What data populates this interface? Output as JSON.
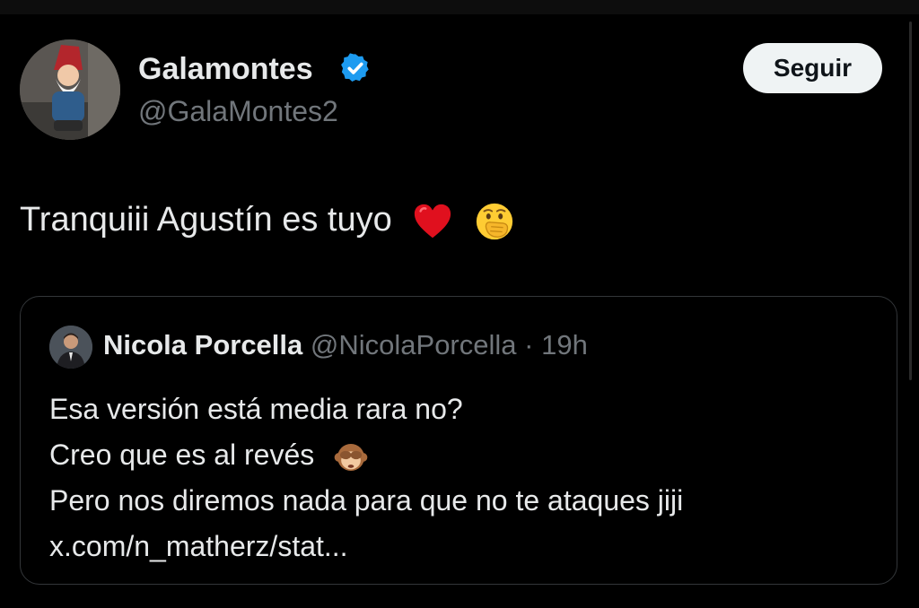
{
  "tweet": {
    "author_name": "Galamontes",
    "author_handle": "@GalaMontes2",
    "follow_label": "Seguir",
    "text": "Tranquiii Agustín es tuyo",
    "emojis": [
      "red-heart-emoji",
      "face-with-hand-over-mouth-emoji"
    ]
  },
  "quote": {
    "author_name": "Nicola Porcella",
    "author_handle": "@NicolaPorcella",
    "separator": "·",
    "time": "19h",
    "lines": [
      "Esa versión está media rara no?",
      "Creo que es al revés",
      "Pero nos diremos nada para que no te ataques jiji",
      "x.com/n_matherz/stat..."
    ],
    "line2_emoji": "see-no-evil-monkey-emoji"
  },
  "colors": {
    "background": "#000000",
    "text": "#e7e9ea",
    "secondary_text": "#71767b",
    "verified_badge": "#1d9bf0",
    "follow_button_bg": "#eff3f4",
    "quote_border": "#333639"
  }
}
